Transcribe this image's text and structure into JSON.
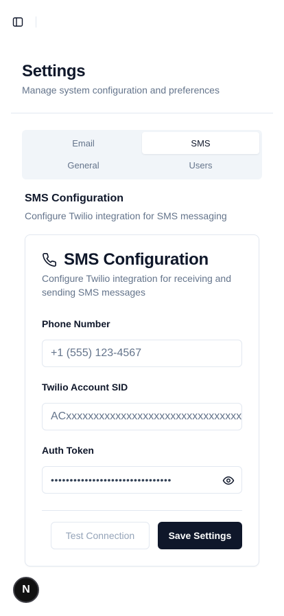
{
  "header": {
    "title": "Settings",
    "subtitle": "Manage system configuration and preferences"
  },
  "tabs": [
    {
      "label": "Email",
      "active": false
    },
    {
      "label": "SMS",
      "active": true
    },
    {
      "label": "General",
      "active": false
    },
    {
      "label": "Users",
      "active": false
    }
  ],
  "section": {
    "heading": "SMS Configuration",
    "description": "Configure Twilio integration for SMS messaging"
  },
  "card": {
    "icon": "phone-icon",
    "title": "SMS Configuration",
    "description": "Configure Twilio integration for receiving and sending SMS messages",
    "fields": {
      "phone": {
        "label": "Phone Number",
        "placeholder": "+1 (555) 123-4567",
        "value": ""
      },
      "sid": {
        "label": "Twilio Account SID",
        "placeholder": "ACxxxxxxxxxxxxxxxxxxxxxxxxxxxxxxxx",
        "value": ""
      },
      "token": {
        "label": "Auth Token",
        "masked_value": "••••••••••••••••••••••••••••••••"
      }
    },
    "buttons": {
      "test": "Test Connection",
      "save": "Save Settings"
    }
  },
  "badge": {
    "letter": "N"
  },
  "colors": {
    "primary": "#0f172a",
    "muted": "#64748b",
    "border": "#e2e8f0",
    "tab_bg": "#f1f5f9"
  }
}
